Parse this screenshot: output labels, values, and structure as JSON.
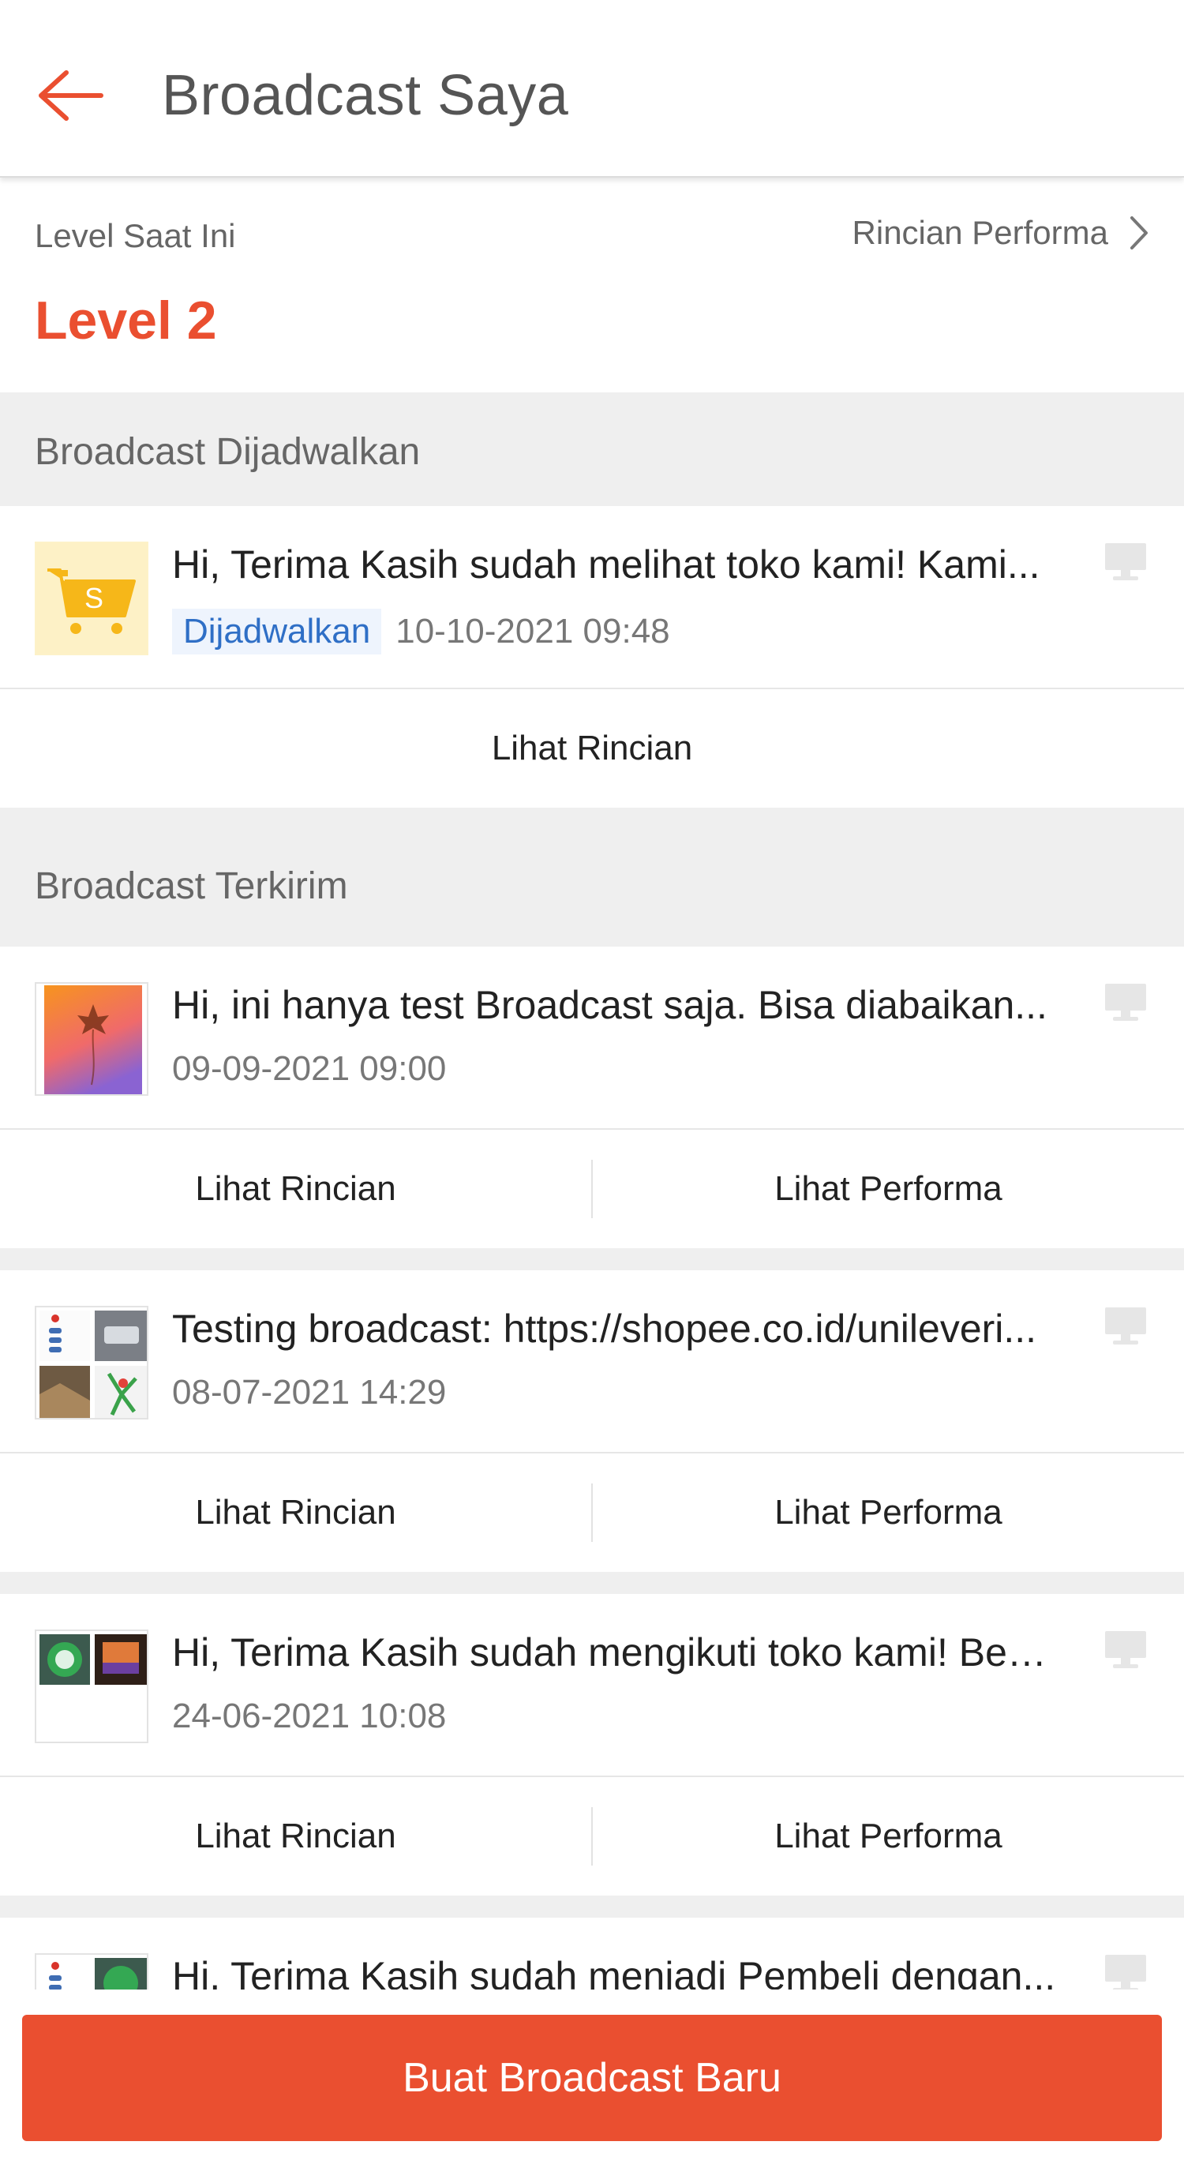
{
  "header": {
    "title": "Broadcast Saya"
  },
  "level": {
    "label": "Level Saat Ini",
    "value": "Level 2",
    "link_label": "Rincian Performa"
  },
  "sections": {
    "scheduled": "Broadcast Dijadwalkan",
    "sent": "Broadcast Terkirim"
  },
  "scheduled_item": {
    "message": "Hi, Terima Kasih sudah melihat toko kami! Kami...",
    "status": "Dijadwalkan",
    "date": "10-10-2021 09:48",
    "action_detail": "Lihat Rincian",
    "thumb_icon": "shopping-cart-icon"
  },
  "sent_items": [
    {
      "message": "Hi, ini hanya test Broadcast saja.  Bisa diabaikan...",
      "date": "09-09-2021 09:00",
      "action_detail": "Lihat Rincian",
      "action_performance": "Lihat Performa"
    },
    {
      "message": "Testing broadcast: https://shopee.co.id/unileveri...",
      "date": "08-07-2021 14:29",
      "action_detail": "Lihat Rincian",
      "action_performance": "Lihat Performa"
    },
    {
      "message": "Hi, Terima Kasih sudah mengikuti toko kami! Beri...",
      "date": "24-06-2021 10:08",
      "action_detail": "Lihat Rincian",
      "action_performance": "Lihat Performa"
    },
    {
      "message": "Hi, Terima Kasih sudah menjadi Pembeli dengan..."
    }
  ],
  "footer": {
    "button_label": "Buat Broadcast Baru"
  },
  "colors": {
    "accent": "#ea4f30",
    "badge_text": "#2f6fc6",
    "badge_bg": "#eef4fd",
    "section_bg": "#efefef"
  }
}
